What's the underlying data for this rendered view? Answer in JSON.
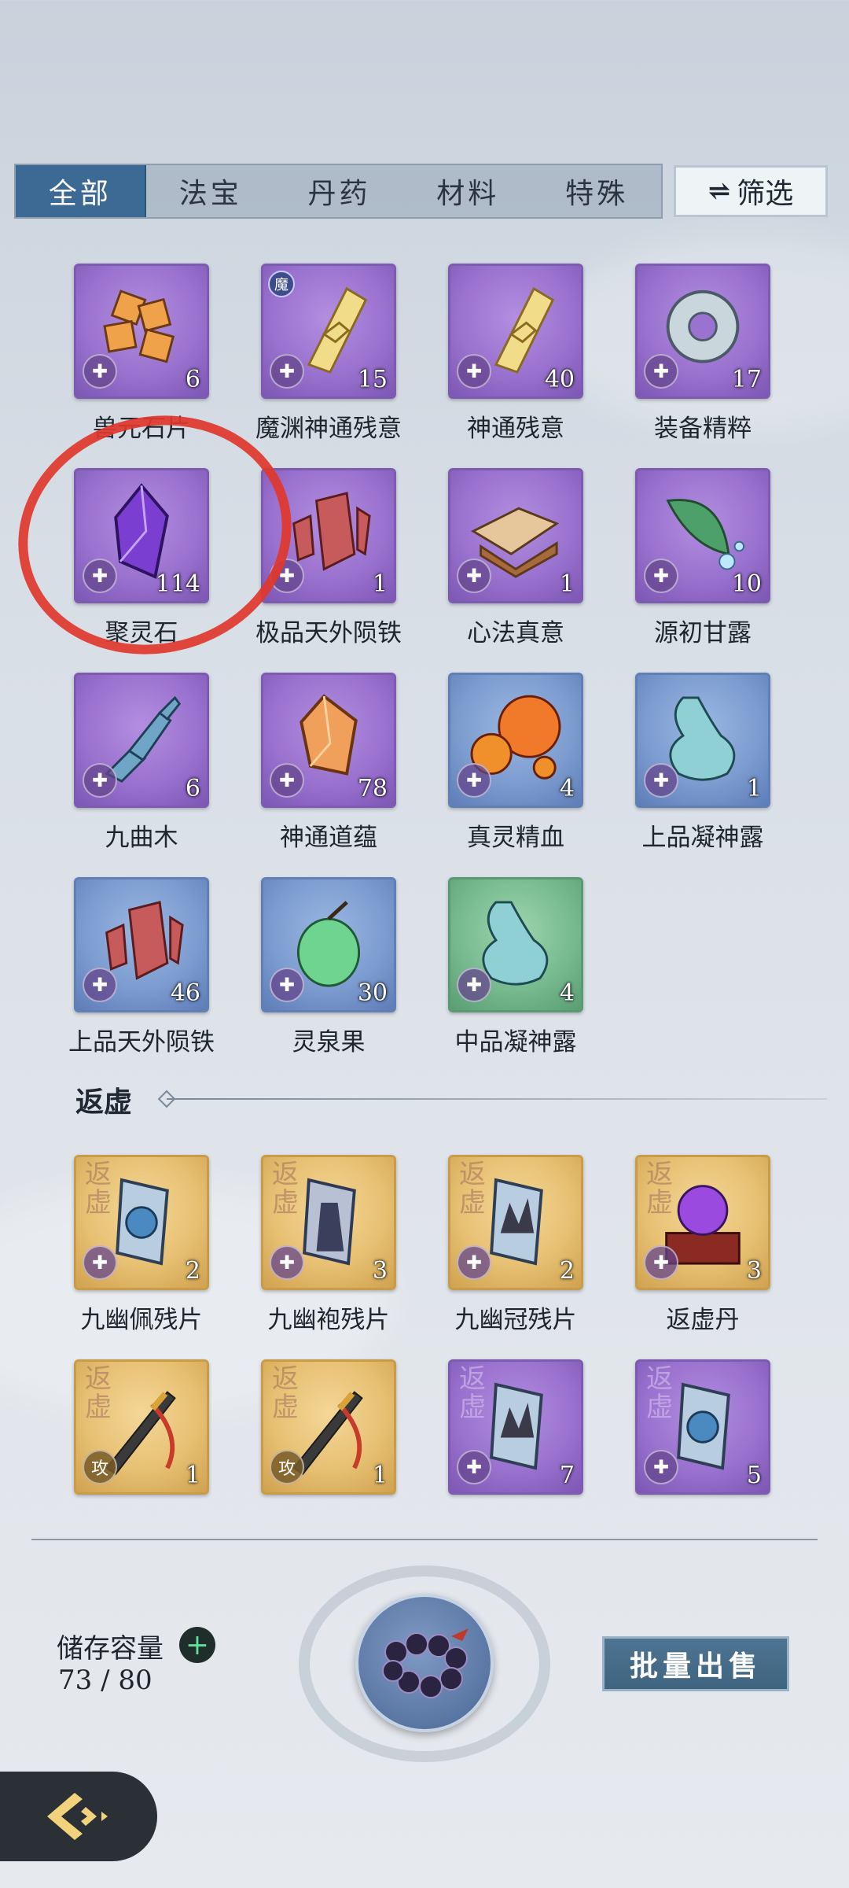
{
  "tabs": {
    "all": "全部",
    "treasure": "法宝",
    "pill": "丹药",
    "material": "材料",
    "special": "特殊"
  },
  "filter_label": "筛选",
  "items": [
    {
      "name": "兽元石片",
      "qty": "6",
      "color": "purple",
      "icon": "beast-shard-icon"
    },
    {
      "name": "魔渊神通残意",
      "qty": "15",
      "color": "purple",
      "icon": "talisman-scroll-icon",
      "tag": "魔"
    },
    {
      "name": "神通残意",
      "qty": "40",
      "color": "purple",
      "icon": "talisman-scroll-icon"
    },
    {
      "name": "装备精粹",
      "qty": "17",
      "color": "purple",
      "icon": "jade-ring-icon"
    },
    {
      "name": "聚灵石",
      "qty": "114",
      "color": "purple",
      "icon": "spirit-crystal-icon"
    },
    {
      "name": "极品天外陨铁",
      "qty": "1",
      "color": "purple",
      "icon": "meteor-iron-icon"
    },
    {
      "name": "心法真意",
      "qty": "1",
      "color": "purple",
      "icon": "ancient-tome-icon"
    },
    {
      "name": "源初甘露",
      "qty": "10",
      "color": "purple",
      "icon": "dew-leaf-icon"
    },
    {
      "name": "九曲木",
      "qty": "6",
      "color": "purple",
      "icon": "twisted-wood-icon"
    },
    {
      "name": "神通道蕴",
      "qty": "78",
      "color": "purple",
      "icon": "amber-crystal-icon"
    },
    {
      "name": "真灵精血",
      "qty": "4",
      "color": "blue",
      "icon": "blood-orb-icon"
    },
    {
      "name": "上品凝神露",
      "qty": "1",
      "color": "blue",
      "icon": "gourd-icon"
    },
    {
      "name": "上品天外陨铁",
      "qty": "46",
      "color": "blue",
      "icon": "meteor-iron-icon"
    },
    {
      "name": "灵泉果",
      "qty": "30",
      "color": "blue",
      "icon": "spring-fruit-icon"
    },
    {
      "name": "中品凝神露",
      "qty": "4",
      "color": "green",
      "icon": "gourd-icon"
    }
  ],
  "section_title": "返虚",
  "section_items": [
    {
      "name": "九幽佩残片",
      "qty": "2",
      "color": "gold",
      "stamp": "返虚",
      "icon": "pendant-shard-icon"
    },
    {
      "name": "九幽袍残片",
      "qty": "3",
      "color": "gold",
      "stamp": "返虚",
      "icon": "robe-shard-icon"
    },
    {
      "name": "九幽冠残片",
      "qty": "2",
      "color": "gold",
      "stamp": "返虚",
      "icon": "crown-shard-icon"
    },
    {
      "name": "返虚丹",
      "qty": "3",
      "color": "gold",
      "stamp": "返虚",
      "icon": "pill-altar-icon"
    },
    {
      "name": "",
      "qty": "1",
      "color": "gold",
      "stamp": "返虚",
      "icon": "sword-icon",
      "badge": "攻"
    },
    {
      "name": "",
      "qty": "1",
      "color": "gold",
      "stamp": "返虚",
      "icon": "sword-icon",
      "badge": "攻"
    },
    {
      "name": "",
      "qty": "7",
      "color": "purple",
      "stamp": "返虚",
      "icon": "crown-shard-icon"
    },
    {
      "name": "",
      "qty": "5",
      "color": "purple",
      "stamp": "返虚",
      "icon": "pendant-shard-icon"
    }
  ],
  "storage": {
    "label": "储存容量",
    "value": "73 / 80"
  },
  "sell_label": "批量出售",
  "colors": {
    "tab_active": "#3d6a94",
    "purple_tile": "#9a72cf",
    "blue_tile": "#7d9cd0",
    "green_tile": "#78bb90",
    "gold_tile": "#e7c073",
    "highlight_circle": "#e0372c"
  }
}
